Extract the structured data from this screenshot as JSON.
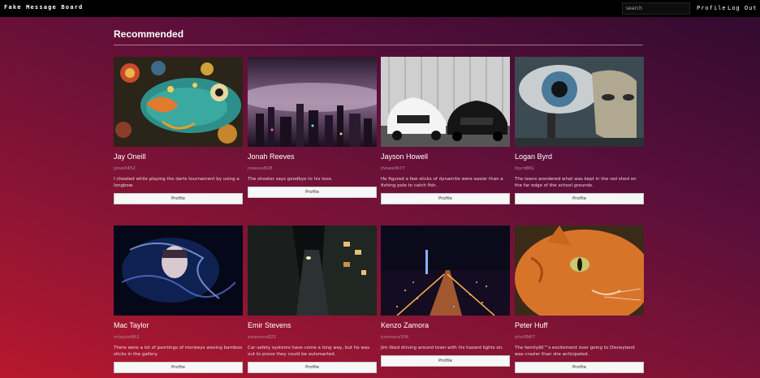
{
  "nav": {
    "brand": "Fake Message Board",
    "search_placeholder": "search",
    "profile_label": "Profile",
    "logout_label": "Log Out"
  },
  "section": {
    "title": "Recommended"
  },
  "cards": [
    {
      "name": "Jay Oneill",
      "handle": "joneill452",
      "message": "I cheated while playing the darts tournament by using a longbow.",
      "button": "Profile",
      "image": "koi-fish-mosaic-art"
    },
    {
      "name": "Jonah Reeves",
      "handle": "jreeves828",
      "message": "The shooter says goodbye to his love.",
      "button": "Profile",
      "image": "foggy-city-night-skyline"
    },
    {
      "name": "Jayson Howell",
      "handle": "jhowell677",
      "message": "He figured a few sticks of dynamite were easier than a fishing pole to catch fish.",
      "button": "Profile",
      "image": "two-audi-cars"
    },
    {
      "name": "Logan Byrd",
      "handle": "lbyrd861",
      "message": "The teens wondered what was kept in the red shed on the far edge of the school grounds.",
      "button": "Profile",
      "image": "surreal-eye-mask"
    },
    {
      "name": "Mac Taylor",
      "handle": "mtaylor862",
      "message": "There were a lot of paintings of monkeys waving bamboo sticks in the gallery.",
      "button": "Profile",
      "image": "smoke-portrait-woman"
    },
    {
      "name": "Emir Stevens",
      "handle": "estevens821",
      "message": "Car safety systems have come a long way, but he was out to prove they could be outsmarted.",
      "button": "Profile",
      "image": "dark-alley-night"
    },
    {
      "name": "Kenzo Zamora",
      "handle": "kzamora306",
      "message": "Jim liked driving around town with his hazard lights on.",
      "button": "Profile",
      "image": "city-lights-aerial"
    },
    {
      "name": "Peter Huff",
      "handle": "phuff967",
      "message": "The familyâ€™s excitement over going to Disneyland was crazier than she anticipated.",
      "button": "Profile",
      "image": "orange-cat-closeup"
    }
  ]
}
